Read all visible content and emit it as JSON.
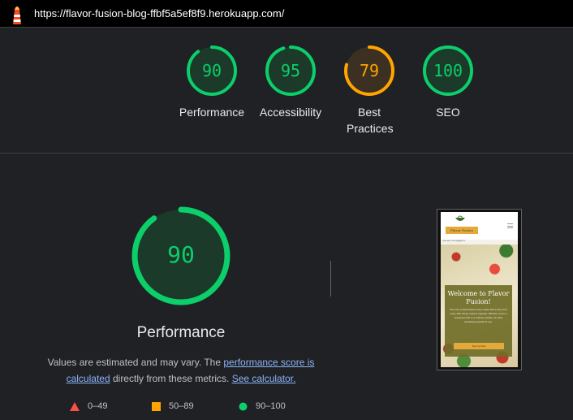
{
  "browser": {
    "url": "https://flavor-fusion-blog-ffbf5a5ef8f9.herokuapp.com/"
  },
  "colors": {
    "pass": "#0cce6b",
    "average": "#ffa400",
    "fail": "#ff4e42",
    "pass_bg": "#1b3a2a",
    "average_bg": "#3b3021"
  },
  "summary": {
    "gauges": [
      {
        "score": "90",
        "label": "Performance",
        "status": "pass"
      },
      {
        "score": "95",
        "label": "Accessibility",
        "status": "pass"
      },
      {
        "score": "79",
        "label": "Best Practices",
        "status": "average"
      },
      {
        "score": "100",
        "label": "SEO",
        "status": "pass"
      }
    ]
  },
  "performance": {
    "score": "90",
    "title": "Performance",
    "desc_part1": "Values are estimated and may vary. The ",
    "desc_link1": "performance score is calculated",
    "desc_part2": " directly from these metrics. ",
    "desc_link2": "See calculator."
  },
  "legend": [
    {
      "range": "0–49",
      "shape": "triangle-icon"
    },
    {
      "range": "50–89",
      "shape": "square-icon"
    },
    {
      "range": "90–100",
      "shape": "circle-icon"
    }
  ],
  "screenshot": {
    "logo": "Flavor Fusion",
    "note": "You are not logged in",
    "heading": "Welcome to Flavor Fusion!",
    "body": "Dive into a world where every recipe tells a story and every dish brings cultures together. Whether you're a seasoned chef or a culinary newbie, we have something special for you.",
    "button": "Sign up Now"
  }
}
